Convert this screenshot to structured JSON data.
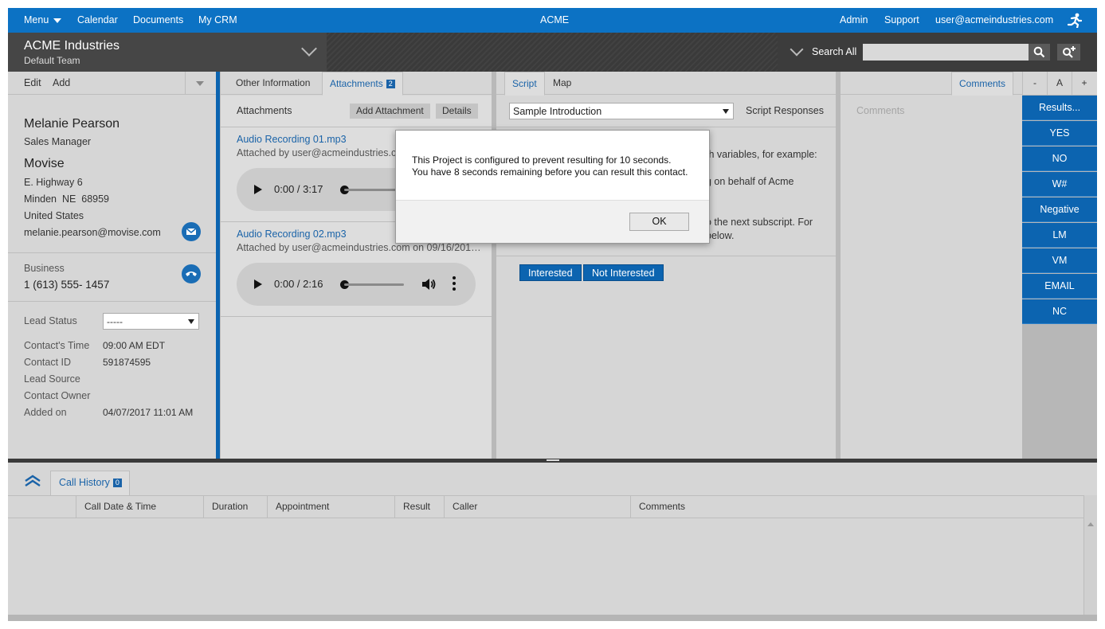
{
  "topnav": {
    "menu": "Menu",
    "calendar": "Calendar",
    "documents": "Documents",
    "my_crm": "My CRM",
    "app_name": "ACME",
    "admin": "Admin",
    "support": "Support",
    "user_email": "user@acmeindustries.com"
  },
  "header": {
    "company": "ACME Industries",
    "team": "Default Team",
    "search_label": "Search All",
    "search_placeholder": ""
  },
  "contact_panel": {
    "edit": "Edit",
    "add": "Add",
    "name": "Melanie Pearson",
    "title": "Sales Manager",
    "company": "Movise",
    "address1": "E. Highway 6",
    "address2": "Minden  NE  68959",
    "country": "United States",
    "email": "melanie.pearson@movise.com",
    "phone_label": "Business",
    "phone": "1 (613) 555- 1457",
    "lead_status_label": "Lead Status",
    "lead_status_value": "-----",
    "fields": {
      "contacts_time_label": "Contact's Time",
      "contacts_time_value": "09:00 AM EDT",
      "contact_id_label": "Contact ID",
      "contact_id_value": "591874595",
      "lead_source_label": "Lead Source",
      "contact_owner_label": "Contact Owner",
      "added_on_label": "Added on",
      "added_on_value": "04/07/2017 11:01 AM"
    }
  },
  "attachments_panel": {
    "tab_other": "Other Information",
    "tab_attachments": "Attachments",
    "attachments_count": "2",
    "section_title": "Attachments",
    "add_attachment": "Add Attachment",
    "details": "Details",
    "items": [
      {
        "name": "Audio Recording 01.mp3",
        "meta": "Attached by user@acmeindustries.com",
        "time": "0:00 / 3:17"
      },
      {
        "name": "Audio Recording 02.mp3",
        "meta": "Attached by user@acmeindustries.com on 09/16/201…",
        "time": "0:00 / 2:16"
      }
    ]
  },
  "script_panel": {
    "tab_script": "Script",
    "tab_map": "Map",
    "selected_script": "Sample Introduction",
    "script_responses": "Script Responses",
    "body_line1": "th variables, for example:",
    "body_line2": "g on behalf of Acme",
    "body_line3": "o the next subscript. For",
    "body_line4": "below.",
    "btn_interested": "Interested",
    "btn_not_interested": "Not Interested"
  },
  "comments_panel": {
    "tab_comments": "Comments",
    "placeholder": "Comments"
  },
  "results": {
    "minus": "-",
    "font": "A",
    "plus": "+",
    "buttons": [
      "Results...",
      "YES",
      "NO",
      "W#",
      "Negative",
      "LM",
      "VM",
      "EMAIL",
      "NC"
    ]
  },
  "call_history": {
    "tab": "Call History",
    "count": "0",
    "columns": [
      "Call Date & Time",
      "Duration",
      "Appointment",
      "Result",
      "Caller",
      "Comments"
    ]
  },
  "modal": {
    "line1": "This Project is configured to prevent resulting for 10 seconds.",
    "line2": "You have 8 seconds remaining before you can result this contact.",
    "ok": "OK"
  },
  "colors": {
    "brand_blue": "#0c72c4",
    "button_blue": "#0c64b0",
    "header_dark": "#3a3a3a"
  }
}
